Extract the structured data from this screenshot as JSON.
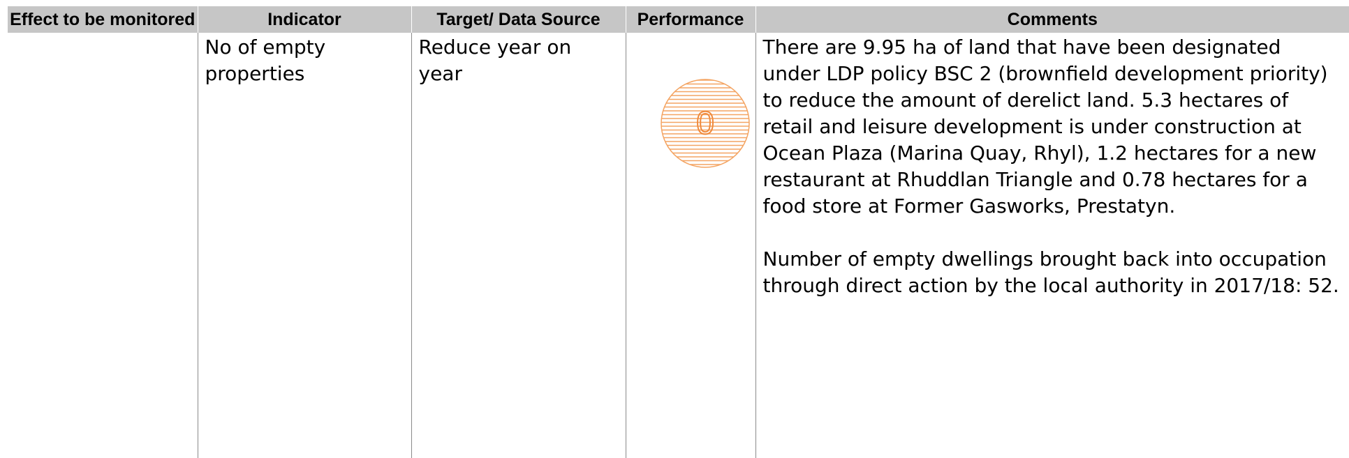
{
  "table": {
    "headers": [
      "Effect to be monitored",
      "Indicator",
      "Target/ Data Source",
      "Performance",
      "Comments"
    ],
    "row": {
      "effect": "",
      "indicator": "No of empty properties",
      "target": "Reduce year on year",
      "performance": {
        "rating": "0",
        "badge_color": "#f4a462",
        "icon": "orange-striped-circle-rating-icon"
      },
      "comments": [
        "There are 9.95 ha of land that have been designated under LDP policy BSC 2 (brownfield development priority) to reduce the amount of derelict land. 5.3 hectares of retail and leisure development is under construction at Ocean Plaza (Marina Quay, Rhyl), 1.2 hectares for a new restaurant at Rhuddlan Triangle and 0.78 hectares for a food store at Former Gasworks, Prestatyn.",
        "Number of empty dwellings brought back into occupation through direct action by the local authority in 2017/18: 52."
      ]
    }
  }
}
